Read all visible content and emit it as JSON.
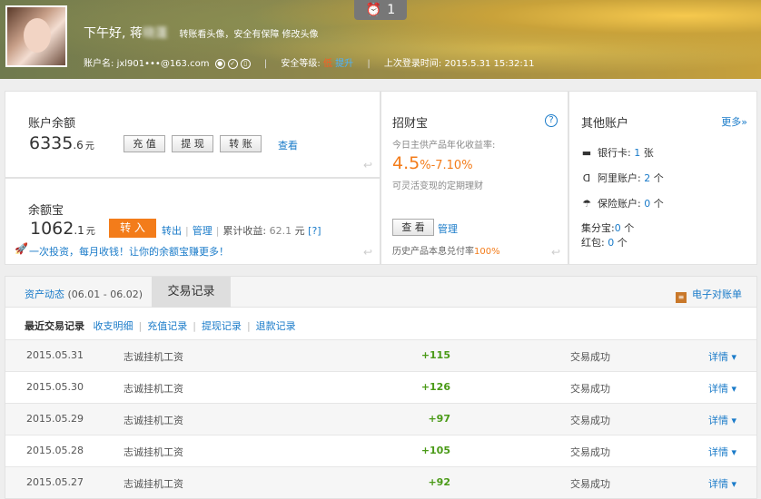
{
  "header": {
    "greeting": "下午好, 蒋",
    "greeting_blur": "晓蓬",
    "hint_transfer": "转账看头像，安全有保障",
    "hint_edit": "修改头像",
    "badge_count": "1",
    "account_label": "账户名:",
    "account_name": "jxl901•••@163.com",
    "security_label": "安全等级:",
    "security_level": "低",
    "upgrade": "提升",
    "last_login_label": "上次登录时间:",
    "last_login": "2015.5.31 15:32:11"
  },
  "balance": {
    "label": "账户余额",
    "amount_int": "6335",
    "amount_dec": ".6",
    "unit": "元",
    "recharge": "充 值",
    "withdraw": "提 现",
    "transfer": "转 账",
    "view": "查看"
  },
  "yeb": {
    "label": "余额宝",
    "amount_int": "1062",
    "amount_dec": ".1",
    "unit": "元",
    "transfer_in": "转 入",
    "transfer_out": "转出",
    "manage": "管理",
    "cum_label": "累计收益:",
    "cum_value": "62.1",
    "cum_unit": "元",
    "cum_q": "[?]",
    "promo": "一次投资，每月收钱！让你的余额宝赚更多！"
  },
  "zcb": {
    "title": "招财宝",
    "help": "?",
    "sub": "今日主供产品年化收益率:",
    "rate_a": "4.5",
    "rate_b": "%-7.10",
    "rate_c": "%",
    "desc": "可灵活变现的定期理财",
    "view": "查 看",
    "manage": "管理",
    "hist_label": "历史产品本息兑付率",
    "hist_pct": "100%"
  },
  "other": {
    "title": "其他账户",
    "more": "更多»",
    "bank_label": "银行卡: ",
    "bank_n": "1",
    "bank_unit": " 张",
    "ali_label": "阿里账户: ",
    "ali_n": "2",
    "ali_unit": " 个",
    "ins_label": "保险账户: ",
    "ins_n": "0",
    "ins_unit": " 个",
    "jfb_label": "集分宝:",
    "jfb_n": "0",
    "jfb_unit": " 个",
    "hb_label": "红包: ",
    "hb_n": "0",
    "hb_unit": " 个"
  },
  "records": {
    "tab_assets": "资产动态",
    "tab_range": " (06.01 - 06.02)",
    "tab_trades": "交易记录",
    "estatement": "电子对账单",
    "subnav": {
      "recent": "最近交易记录",
      "income": "收支明细",
      "recharge": "充值记录",
      "withdraw": "提现记录",
      "refund": "退款记录"
    },
    "detail_label": "详情 ▾",
    "rows": [
      {
        "date": "2015.05.31",
        "desc": "志诚挂机工资",
        "amount": "+115",
        "status": "交易成功"
      },
      {
        "date": "2015.05.30",
        "desc": "志诚挂机工资",
        "amount": "+126",
        "status": "交易成功"
      },
      {
        "date": "2015.05.29",
        "desc": "志诚挂机工资",
        "amount": "+97",
        "status": "交易成功"
      },
      {
        "date": "2015.05.28",
        "desc": "志诚挂机工资",
        "amount": "+105",
        "status": "交易成功"
      },
      {
        "date": "2015.05.27",
        "desc": "志诚挂机工资",
        "amount": "+92",
        "status": "交易成功"
      }
    ]
  }
}
